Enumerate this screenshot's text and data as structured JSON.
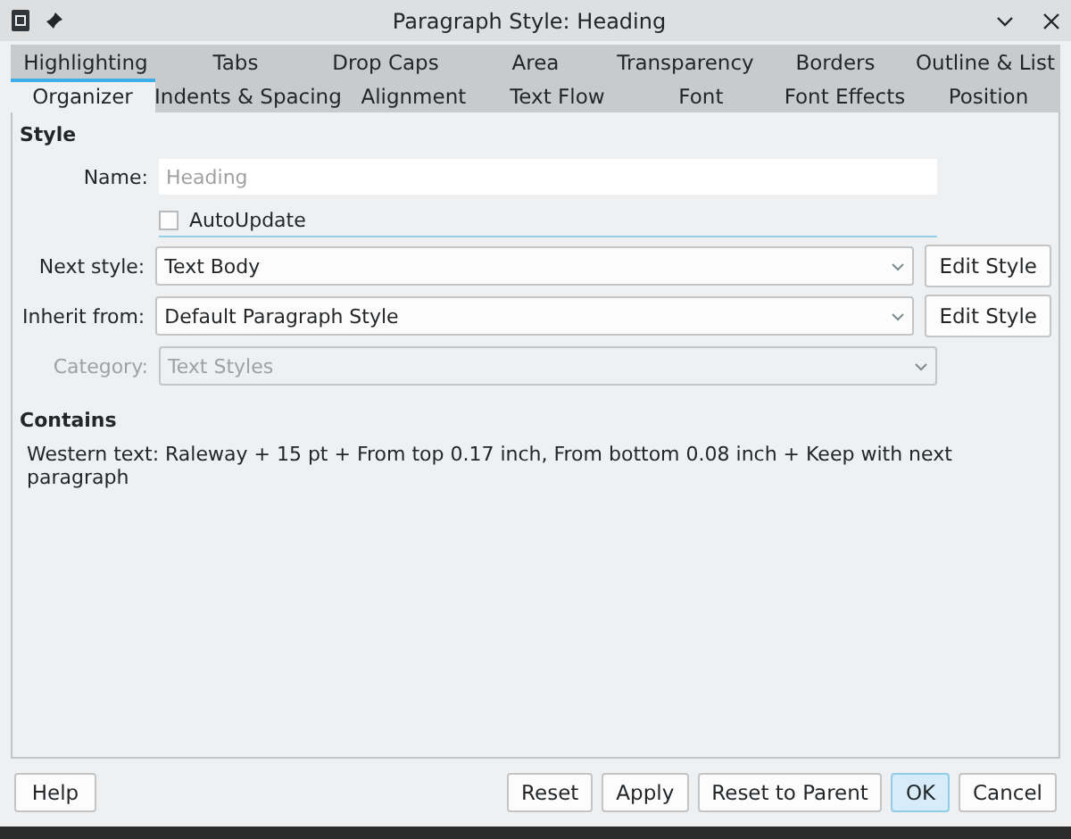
{
  "window": {
    "title": "Paragraph Style: Heading"
  },
  "tab_rows": [
    [
      {
        "label": "Highlighting",
        "selected": false
      },
      {
        "label": "Tabs",
        "selected": false
      },
      {
        "label": "Drop Caps",
        "selected": false
      },
      {
        "label": "Area",
        "selected": false
      },
      {
        "label": "Transparency",
        "selected": false
      },
      {
        "label": "Borders",
        "selected": false
      },
      {
        "label": "Outline & List",
        "selected": false
      }
    ],
    [
      {
        "label": "Organizer",
        "selected": true
      },
      {
        "label": "Indents & Spacing",
        "selected": false
      },
      {
        "label": "Alignment",
        "selected": false
      },
      {
        "label": "Text Flow",
        "selected": false
      },
      {
        "label": "Font",
        "selected": false
      },
      {
        "label": "Font Effects",
        "selected": false
      },
      {
        "label": "Position",
        "selected": false
      }
    ]
  ],
  "style_section": {
    "heading": "Style",
    "name": {
      "label": "Name:",
      "placeholder": "Heading"
    },
    "autoupdate": {
      "label": "AutoUpdate",
      "checked": false
    },
    "fields": [
      {
        "label": "Next style:",
        "value": "Text Body",
        "disabled": false,
        "button": "Edit Style"
      },
      {
        "label": "Inherit from:",
        "value": "Default Paragraph Style",
        "disabled": false,
        "button": "Edit Style"
      },
      {
        "label": "Category:",
        "value": "Text Styles",
        "disabled": true
      }
    ]
  },
  "contains": {
    "heading": "Contains",
    "text": "Western text: Raleway + 15 pt + From top 0.17 inch, From bottom 0.08 inch + Keep with next paragraph"
  },
  "buttons": [
    {
      "label": "Help",
      "kind": "left",
      "default": false
    },
    {
      "label": "Reset",
      "kind": "right",
      "default": false
    },
    {
      "label": "Apply",
      "kind": "right",
      "default": false
    },
    {
      "label": "Reset to Parent",
      "kind": "right",
      "default": false
    },
    {
      "label": "OK",
      "kind": "right",
      "default": true
    },
    {
      "label": "Cancel",
      "kind": "right",
      "default": false
    }
  ]
}
